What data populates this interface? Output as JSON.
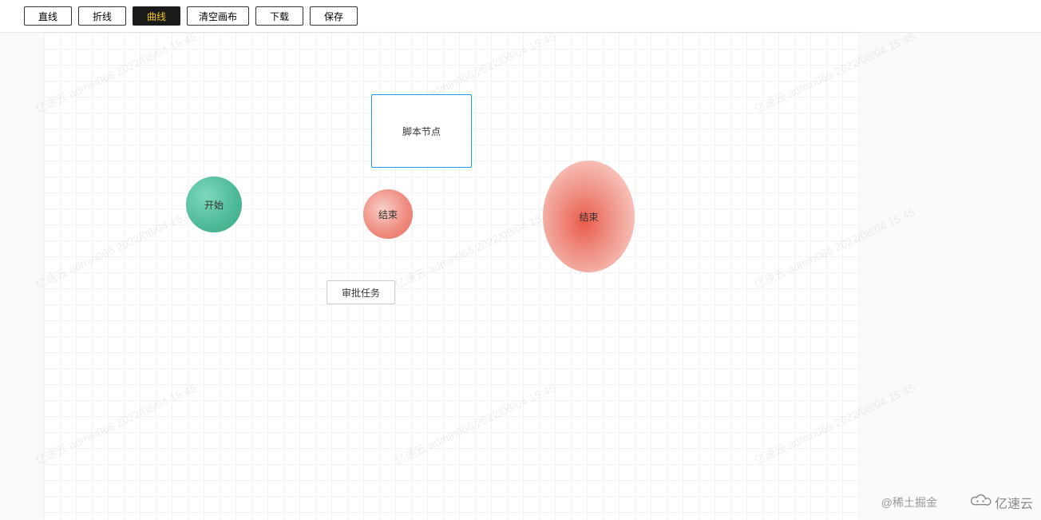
{
  "toolbar": {
    "buttons": [
      {
        "label": "直线",
        "active": false
      },
      {
        "label": "折线",
        "active": false
      },
      {
        "label": "曲线",
        "active": true
      },
      {
        "label": "清空画布",
        "active": false
      },
      {
        "label": "下载",
        "active": false
      },
      {
        "label": "保存",
        "active": false
      }
    ]
  },
  "nodes": {
    "start": {
      "label": "开始"
    },
    "script": {
      "label": "脚本节点"
    },
    "end_small": {
      "label": "结束"
    },
    "end_large": {
      "label": "结束"
    },
    "approve": {
      "label": "审批任务"
    }
  },
  "watermark_text": "亿速云 admin066 2022/08/04 15:45",
  "brands": {
    "xitu": "@稀土掘金",
    "yisu": "亿速云"
  }
}
